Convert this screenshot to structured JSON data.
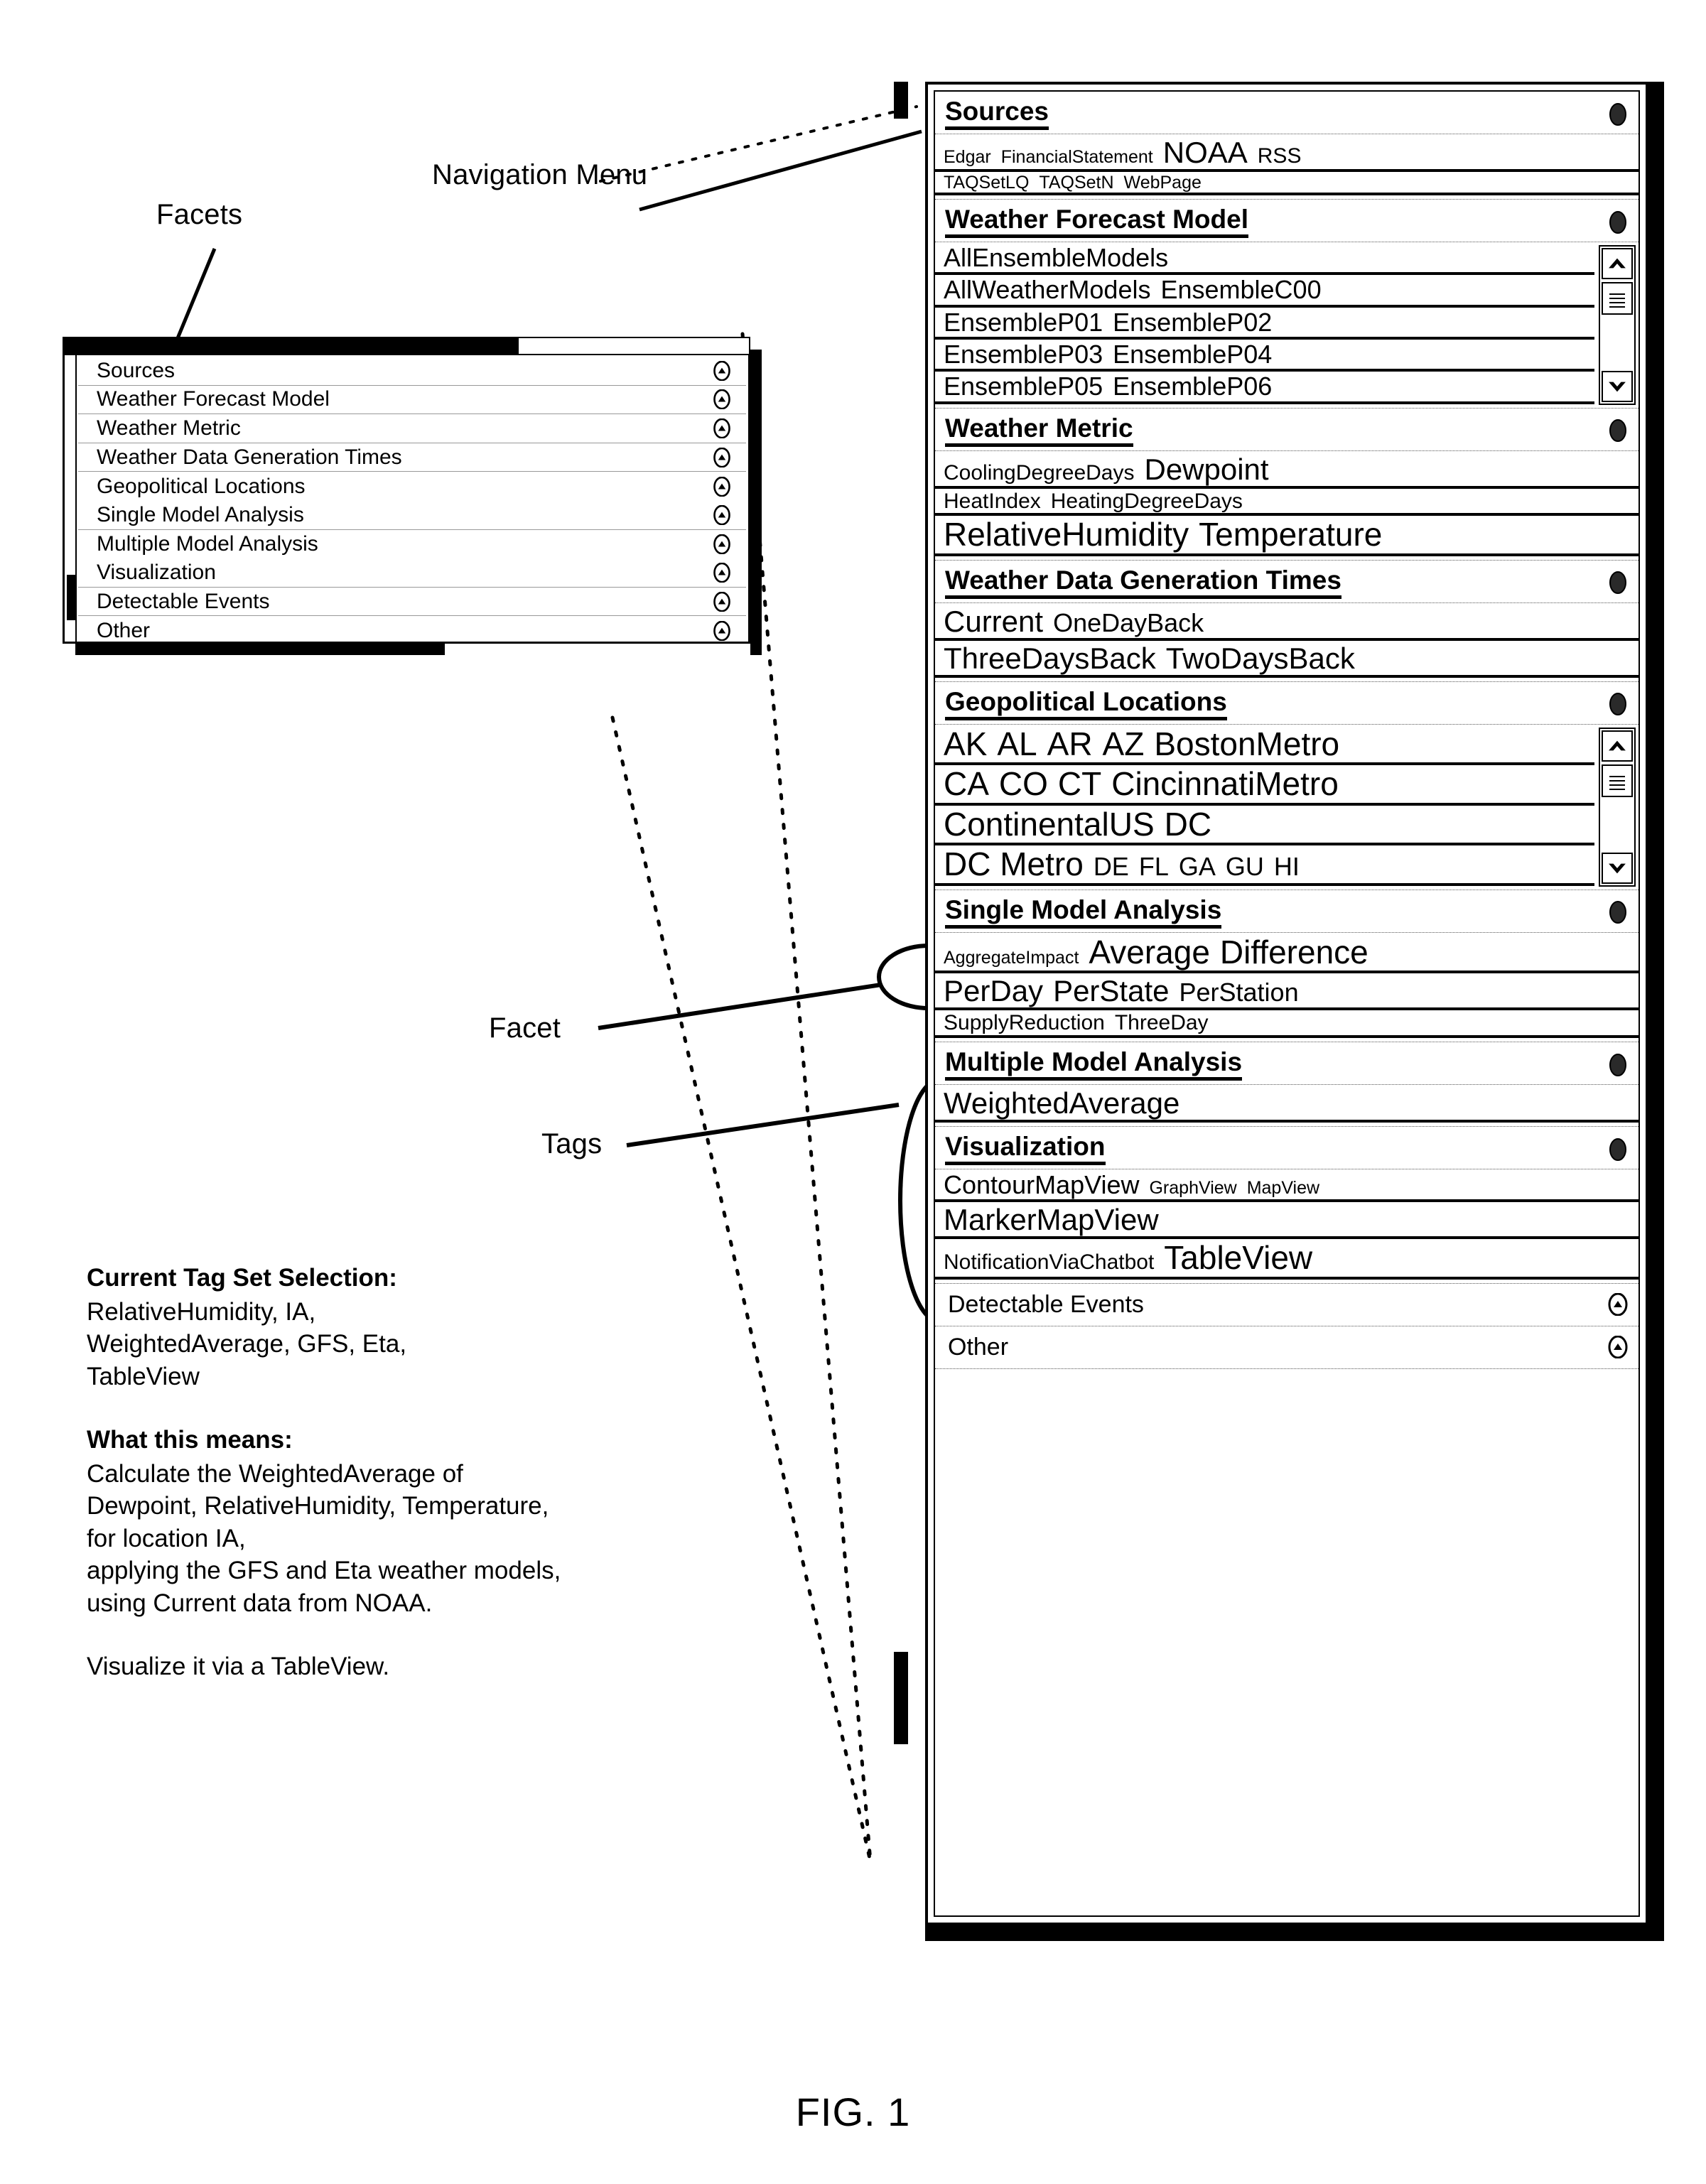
{
  "annotations": {
    "facets_label": "Facets",
    "navigation_menu_label": "Navigation Menu",
    "facet_label": "Facet",
    "tags_label": "Tags"
  },
  "figure": {
    "caption": "FIG. 1"
  },
  "facets_panel": {
    "items": [
      {
        "label": "Sources",
        "icon": "collapse-chevron-icon"
      },
      {
        "label": "Weather Forecast Model",
        "icon": "collapse-chevron-icon"
      },
      {
        "label": "Weather Metric",
        "icon": "collapse-chevron-icon"
      },
      {
        "label": "Weather Data Generation Times",
        "icon": "collapse-chevron-icon"
      },
      {
        "label": "Geopolitical Locations",
        "icon": "collapse-chevron-icon"
      },
      {
        "label": "Single Model Analysis",
        "icon": "collapse-chevron-icon"
      },
      {
        "label": "Multiple Model Analysis",
        "icon": "collapse-chevron-icon"
      },
      {
        "label": "Visualization",
        "icon": "collapse-chevron-icon"
      },
      {
        "label": "Detectable Events",
        "icon": "collapse-chevron-icon"
      },
      {
        "label": "Other",
        "icon": "collapse-chevron-icon"
      }
    ]
  },
  "nav_panel": {
    "sections": [
      {
        "title": "Sources",
        "icon": "expand-toggle-icon",
        "expanded": true,
        "scrollbar": false,
        "lines": [
          [
            {
              "text": "Edgar",
              "size": "s-xs"
            },
            {
              "text": "FinancialStatement",
              "size": "s-xs"
            },
            {
              "text": "NOAA",
              "size": "s-lg"
            },
            {
              "text": "RSS",
              "size": "s-sm"
            }
          ],
          [
            {
              "text": "TAQSetLQ",
              "size": "s-xs"
            },
            {
              "text": "TAQSetN",
              "size": "s-xs"
            },
            {
              "text": "WebPage",
              "size": "s-xs"
            }
          ]
        ]
      },
      {
        "title": "Weather Forecast Model",
        "icon": "expand-toggle-icon",
        "expanded": true,
        "scrollbar": true,
        "lines": [
          [
            {
              "text": "AllEnsembleModels",
              "size": "s-md"
            }
          ],
          [
            {
              "text": "AllWeatherModels",
              "size": "s-md"
            },
            {
              "text": "EnsembleC00",
              "size": "s-md"
            }
          ],
          [
            {
              "text": "EnsembleP01",
              "size": "s-md"
            },
            {
              "text": "EnsembleP02",
              "size": "s-md"
            }
          ],
          [
            {
              "text": "EnsembleP03",
              "size": "s-md"
            },
            {
              "text": "EnsembleP04",
              "size": "s-md"
            }
          ],
          [
            {
              "text": "EnsembleP05",
              "size": "s-md"
            },
            {
              "text": "EnsembleP06",
              "size": "s-md"
            }
          ]
        ]
      },
      {
        "title": "Weather Metric",
        "icon": "expand-toggle-icon",
        "expanded": true,
        "scrollbar": false,
        "lines": [
          [
            {
              "text": "CoolingDegreeDays",
              "size": "s-sm"
            },
            {
              "text": "Dewpoint",
              "size": "s-lg"
            }
          ],
          [
            {
              "text": "HeatIndex",
              "size": "s-sm"
            },
            {
              "text": "HeatingDegreeDays",
              "size": "s-sm"
            }
          ],
          [
            {
              "text": "RelativeHumidity",
              "size": "s-xl"
            },
            {
              "text": "Temperature",
              "size": "s-xl"
            }
          ]
        ]
      },
      {
        "title": "Weather Data Generation Times",
        "icon": "expand-toggle-icon",
        "expanded": true,
        "scrollbar": false,
        "lines": [
          [
            {
              "text": "Current",
              "size": "s-lg"
            },
            {
              "text": "OneDayBack",
              "size": "s-md"
            }
          ],
          [
            {
              "text": "ThreeDaysBack",
              "size": "s-lg"
            },
            {
              "text": "TwoDaysBack",
              "size": "s-lg"
            }
          ]
        ]
      },
      {
        "title": "Geopolitical Locations",
        "icon": "expand-toggle-icon",
        "expanded": true,
        "scrollbar": true,
        "lines": [
          [
            {
              "text": "AK",
              "size": "s-xl"
            },
            {
              "text": "AL",
              "size": "s-xl"
            },
            {
              "text": "AR",
              "size": "s-xl"
            },
            {
              "text": "AZ",
              "size": "s-xl"
            },
            {
              "text": "BostonMetro",
              "size": "s-xl"
            }
          ],
          [
            {
              "text": "CA",
              "size": "s-xl"
            },
            {
              "text": "CO",
              "size": "s-xl"
            },
            {
              "text": "CT",
              "size": "s-xl"
            },
            {
              "text": "CincinnatiMetro",
              "size": "s-xl"
            }
          ],
          [
            {
              "text": "ContinentalUS",
              "size": "s-xl"
            },
            {
              "text": "DC",
              "size": "s-xl"
            }
          ],
          [
            {
              "text": "DC Metro",
              "size": "s-xl"
            },
            {
              "text": "DE",
              "size": "s-md"
            },
            {
              "text": "FL",
              "size": "s-md"
            },
            {
              "text": "GA",
              "size": "s-md"
            },
            {
              "text": "GU",
              "size": "s-md"
            },
            {
              "text": "HI",
              "size": "s-md"
            }
          ]
        ]
      },
      {
        "title": "Single Model Analysis",
        "icon": "expand-toggle-icon",
        "expanded": true,
        "scrollbar": false,
        "lines": [
          [
            {
              "text": "AggregateImpact",
              "size": "s-xs"
            },
            {
              "text": "Average",
              "size": "s-xl"
            },
            {
              "text": "Difference",
              "size": "s-xl"
            }
          ],
          [
            {
              "text": "PerDay",
              "size": "s-lg"
            },
            {
              "text": "PerState",
              "size": "s-lg"
            },
            {
              "text": "PerStation",
              "size": "s-md"
            }
          ],
          [
            {
              "text": "SupplyReduction",
              "size": "s-sm"
            },
            {
              "text": "ThreeDay",
              "size": "s-sm"
            }
          ]
        ]
      },
      {
        "title": "Multiple Model Analysis",
        "icon": "expand-toggle-icon",
        "expanded": true,
        "scrollbar": false,
        "lines": [
          [
            {
              "text": "WeightedAverage",
              "size": "s-lg"
            }
          ]
        ]
      },
      {
        "title": "Visualization",
        "icon": "expand-toggle-icon",
        "expanded": true,
        "scrollbar": false,
        "lines": [
          [
            {
              "text": "ContourMapView",
              "size": "s-md"
            },
            {
              "text": "GraphView",
              "size": "s-xs"
            },
            {
              "text": "MapView",
              "size": "s-xs"
            }
          ],
          [
            {
              "text": "MarkerMapView",
              "size": "s-lg"
            }
          ],
          [
            {
              "text": "NotificationViaChatbot",
              "size": "s-sm"
            },
            {
              "text": "TableView",
              "size": "s-xl"
            }
          ]
        ]
      }
    ],
    "collapsed_sections": [
      {
        "title": "Detectable Events",
        "icon": "collapse-chevron-icon"
      },
      {
        "title": "Other",
        "icon": "collapse-chevron-icon"
      }
    ]
  },
  "explanation": {
    "selection_heading": "Current Tag Set Selection:",
    "selection_lines": [
      "RelativeHumidity, IA,",
      "WeightedAverage, GFS, Eta,",
      "TableView"
    ],
    "meaning_heading": "What this means:",
    "meaning_lines": [
      "Calculate the WeightedAverage of",
      "Dewpoint, RelativeHumidity, Temperature,",
      "for location IA,",
      "applying the GFS and Eta weather models,",
      "using Current data from NOAA."
    ],
    "closing_line": "Visualize it via a TableView."
  }
}
